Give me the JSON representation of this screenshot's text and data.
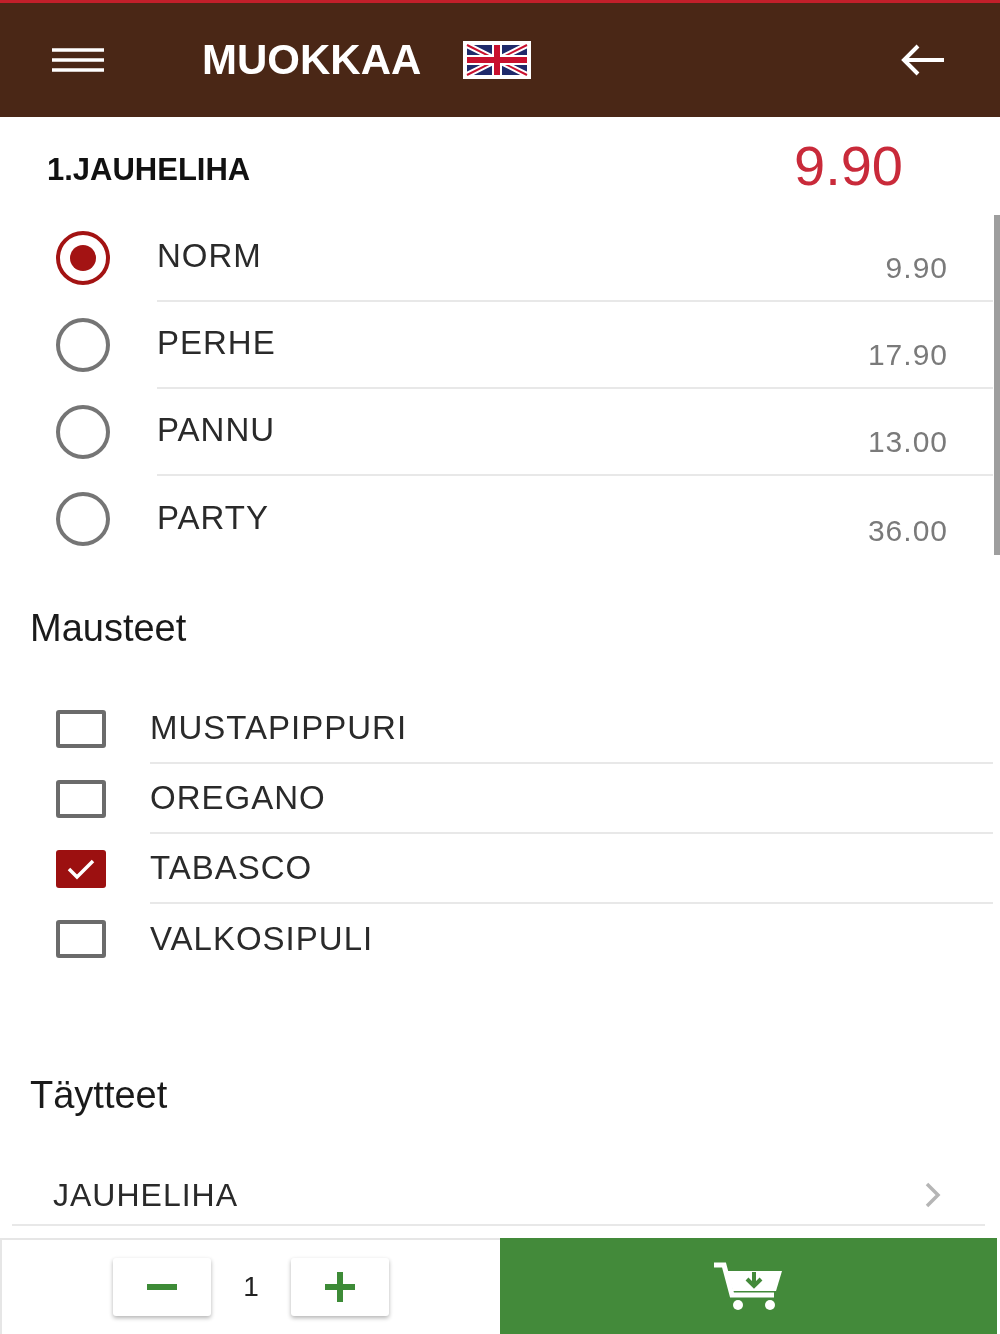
{
  "header": {
    "title": "MUOKKAA"
  },
  "product": {
    "name": "1.JAUHELIHA",
    "price": "9.90"
  },
  "sizes": [
    {
      "label": "NORM",
      "price": "9.90",
      "selected": true
    },
    {
      "label": "PERHE",
      "price": "17.90",
      "selected": false
    },
    {
      "label": "PANNU",
      "price": "13.00",
      "selected": false
    },
    {
      "label": "PARTY",
      "price": "36.00",
      "selected": false
    }
  ],
  "spices": {
    "title": "Mausteet",
    "items": [
      {
        "label": "MUSTAPIPPURI",
        "checked": false
      },
      {
        "label": "OREGANO",
        "checked": false
      },
      {
        "label": "TABASCO",
        "checked": true
      },
      {
        "label": "VALKOSIPULI",
        "checked": false
      }
    ]
  },
  "fillings": {
    "title": "Täytteet",
    "items": [
      {
        "label": "JAUHELIHA"
      }
    ]
  },
  "footer": {
    "quantity": "1"
  }
}
